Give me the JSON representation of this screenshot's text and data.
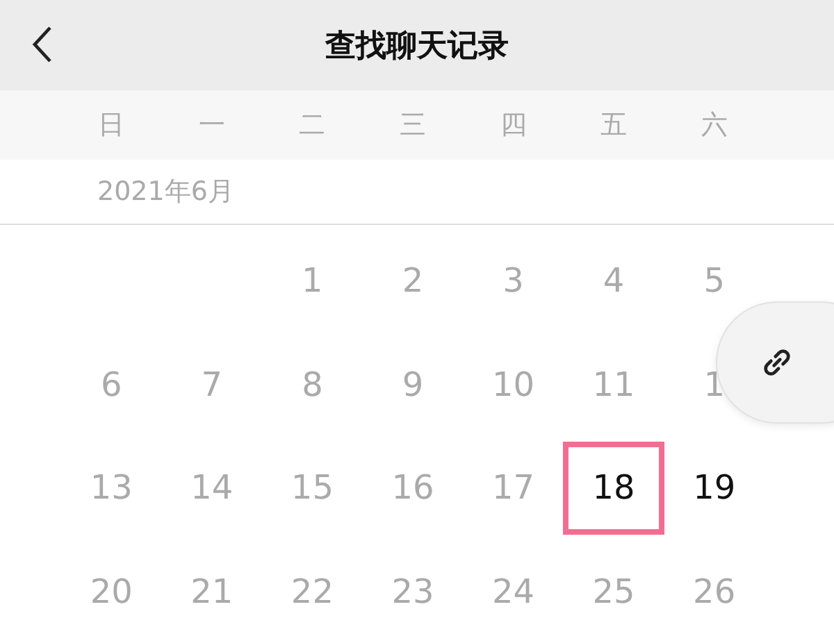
{
  "header": {
    "title": "查找聊天记录"
  },
  "weekdays": [
    "日",
    "一",
    "二",
    "三",
    "四",
    "五",
    "六"
  ],
  "month": "2021年6月",
  "weeks": [
    {
      "align_end": true,
      "days": [
        {
          "label": "1",
          "disabled": true,
          "selected": false
        },
        {
          "label": "2",
          "disabled": true,
          "selected": false
        },
        {
          "label": "3",
          "disabled": true,
          "selected": false
        },
        {
          "label": "4",
          "disabled": true,
          "selected": false
        },
        {
          "label": "5",
          "disabled": true,
          "selected": false
        }
      ]
    },
    {
      "align_end": false,
      "days": [
        {
          "label": "6",
          "disabled": true,
          "selected": false
        },
        {
          "label": "7",
          "disabled": true,
          "selected": false
        },
        {
          "label": "8",
          "disabled": true,
          "selected": false
        },
        {
          "label": "9",
          "disabled": true,
          "selected": false
        },
        {
          "label": "10",
          "disabled": true,
          "selected": false
        },
        {
          "label": "11",
          "disabled": true,
          "selected": false
        },
        {
          "label": "1",
          "disabled": true,
          "selected": false
        }
      ]
    },
    {
      "align_end": false,
      "days": [
        {
          "label": "13",
          "disabled": true,
          "selected": false
        },
        {
          "label": "14",
          "disabled": true,
          "selected": false
        },
        {
          "label": "15",
          "disabled": true,
          "selected": false
        },
        {
          "label": "16",
          "disabled": true,
          "selected": false
        },
        {
          "label": "17",
          "disabled": true,
          "selected": false
        },
        {
          "label": "18",
          "disabled": false,
          "selected": true
        },
        {
          "label": "19",
          "disabled": false,
          "selected": false
        }
      ]
    },
    {
      "align_end": false,
      "days": [
        {
          "label": "20",
          "disabled": true,
          "selected": false
        },
        {
          "label": "21",
          "disabled": true,
          "selected": false
        },
        {
          "label": "22",
          "disabled": true,
          "selected": false
        },
        {
          "label": "23",
          "disabled": true,
          "selected": false
        },
        {
          "label": "24",
          "disabled": true,
          "selected": false
        },
        {
          "label": "25",
          "disabled": true,
          "selected": false
        },
        {
          "label": "26",
          "disabled": true,
          "selected": false
        }
      ]
    }
  ]
}
